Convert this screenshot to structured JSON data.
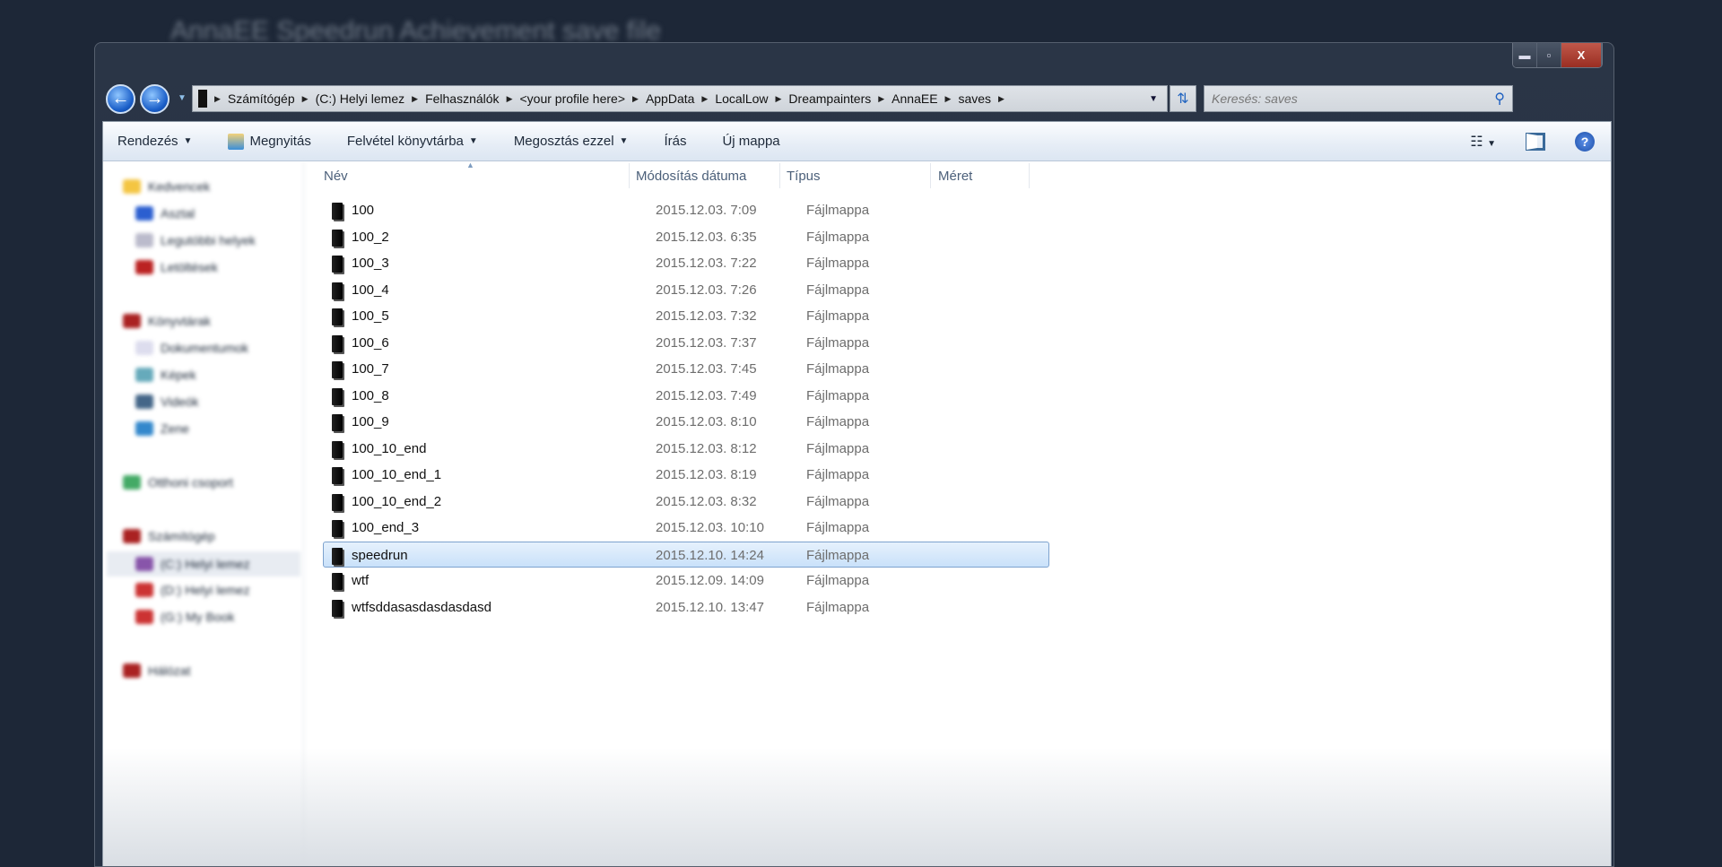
{
  "background_title": "AnnaEE Speedrun Achievement save file",
  "window_controls": {
    "minimize": "▬",
    "maximize": "▫",
    "close": "X"
  },
  "nav": {
    "back": "←",
    "forward": "→"
  },
  "address": {
    "crumbs": [
      "Számítógép",
      "(C:) Helyi lemez",
      "Felhasználók",
      "<your profile here>",
      "AppData",
      "LocalLow",
      "Dreampainters",
      "AnnaEE",
      "saves"
    ]
  },
  "search": {
    "placeholder": "Keresés: saves"
  },
  "toolbar": {
    "organize": "Rendezés",
    "open": "Megnyitás",
    "include_library": "Felvétel könyvtárba",
    "share_with": "Megosztás ezzel",
    "burn": "Írás",
    "new_folder": "Új mappa"
  },
  "sidebar": {
    "items": [
      "Kedvencek",
      "Asztal",
      "Legutóbbi helyek",
      "Letöltések",
      "Könyvtárak",
      "Dokumentumok",
      "Képek",
      "Videók",
      "Zene",
      "Otthoni csoport",
      "Számítógép",
      "(C:) Helyi lemez",
      "(D:) Helyi lemez",
      "(G:) My Book",
      "Hálózat"
    ]
  },
  "columns": {
    "name": "Név",
    "modified": "Módosítás dátuma",
    "type": "Típus",
    "size": "Méret"
  },
  "files": [
    {
      "name": "100",
      "date": "2015.12.03. 7:09",
      "type": "Fájlmappa"
    },
    {
      "name": "100_2",
      "date": "2015.12.03. 6:35",
      "type": "Fájlmappa"
    },
    {
      "name": "100_3",
      "date": "2015.12.03. 7:22",
      "type": "Fájlmappa"
    },
    {
      "name": "100_4",
      "date": "2015.12.03. 7:26",
      "type": "Fájlmappa"
    },
    {
      "name": "100_5",
      "date": "2015.12.03. 7:32",
      "type": "Fájlmappa"
    },
    {
      "name": "100_6",
      "date": "2015.12.03. 7:37",
      "type": "Fájlmappa"
    },
    {
      "name": "100_7",
      "date": "2015.12.03. 7:45",
      "type": "Fájlmappa"
    },
    {
      "name": "100_8",
      "date": "2015.12.03. 7:49",
      "type": "Fájlmappa"
    },
    {
      "name": "100_9",
      "date": "2015.12.03. 8:10",
      "type": "Fájlmappa"
    },
    {
      "name": "100_10_end",
      "date": "2015.12.03. 8:12",
      "type": "Fájlmappa"
    },
    {
      "name": "100_10_end_1",
      "date": "2015.12.03. 8:19",
      "type": "Fájlmappa"
    },
    {
      "name": "100_10_end_2",
      "date": "2015.12.03. 8:32",
      "type": "Fájlmappa"
    },
    {
      "name": "100_end_3",
      "date": "2015.12.03. 10:10",
      "type": "Fájlmappa"
    },
    {
      "name": "speedrun",
      "date": "2015.12.10. 14:24",
      "type": "Fájlmappa",
      "selected": true
    },
    {
      "name": "wtf",
      "date": "2015.12.09. 14:09",
      "type": "Fájlmappa"
    },
    {
      "name": "wtfsddasasdasdasdasd",
      "date": "2015.12.10. 13:47",
      "type": "Fájlmappa"
    }
  ]
}
